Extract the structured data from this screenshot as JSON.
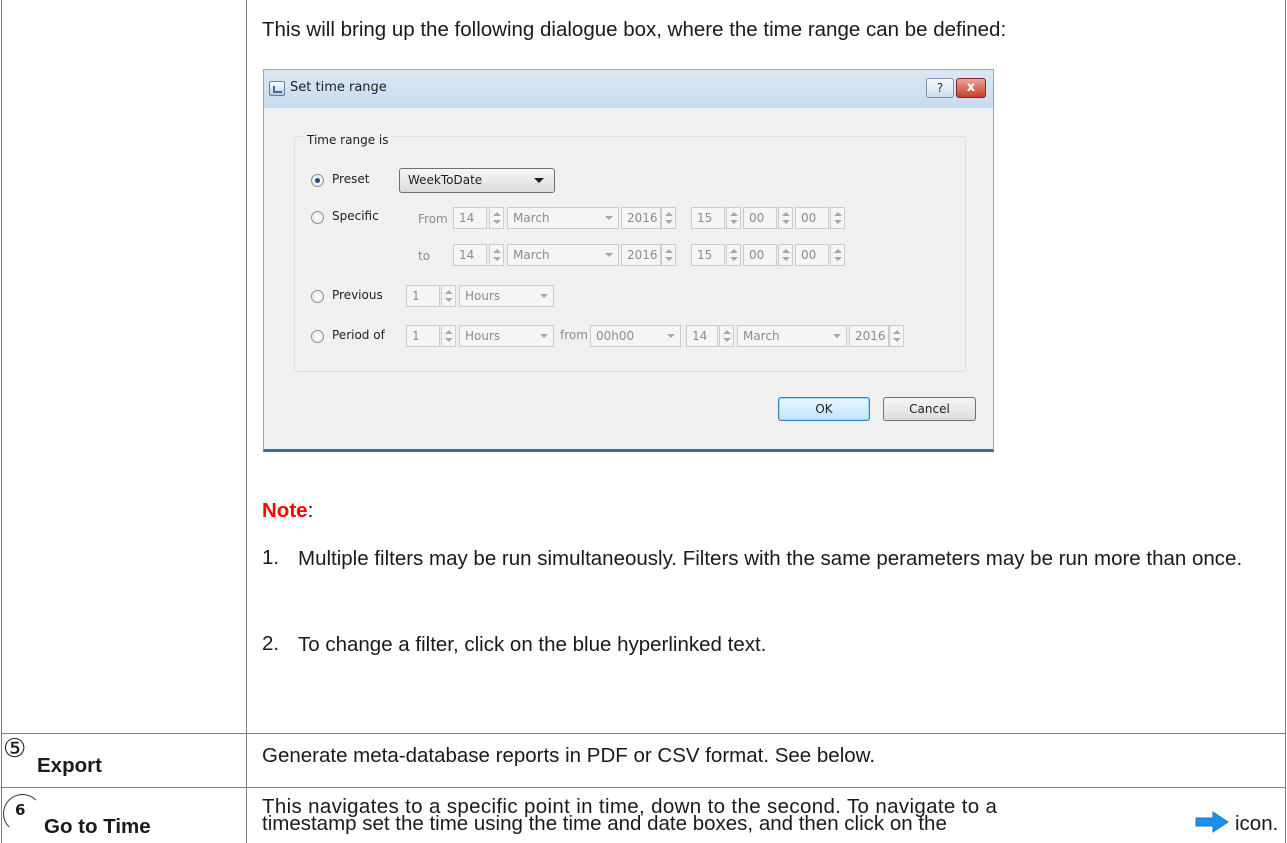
{
  "intro_text": "This will bring up the following dialogue box, where the time range can be defined:",
  "dialog": {
    "title": "Set time range",
    "help_label": "?",
    "close_label": "x",
    "group_label": "Time range is",
    "preset": {
      "label": "Preset",
      "value": "WeekToDate",
      "selected": true
    },
    "specific": {
      "label": "Specific",
      "from_label": "From",
      "to_label": "to",
      "from": {
        "day": "14",
        "month": "March",
        "year": "2016",
        "hour": "15",
        "minute": "00",
        "second": "00"
      },
      "to": {
        "day": "14",
        "month": "March",
        "year": "2016",
        "hour": "15",
        "minute": "00",
        "second": "00"
      }
    },
    "previous": {
      "label": "Previous",
      "amount": "1",
      "unit": "Hours"
    },
    "period_of": {
      "label": "Period of",
      "amount": "1",
      "unit": "Hours",
      "from_label": "from",
      "time": "00h00",
      "day": "14",
      "month": "March",
      "year": "2016"
    },
    "ok_label": "OK",
    "cancel_label": "Cancel"
  },
  "note": {
    "word": "Note",
    "colon": ":",
    "items": [
      {
        "num": "1.",
        "text": "Multiple filters may be run simultaneously. Filters with the same perameters may be run more than once."
      },
      {
        "num": "2.",
        "text": "To change a filter, click on the blue hyperlinked text."
      }
    ]
  },
  "rows": [
    {
      "number": "⑤",
      "title": "Export",
      "description": "Generate meta-database reports in PDF or CSV format. See below."
    },
    {
      "number": "6",
      "title": "Go to Time",
      "description_line1": "This navigates to a specific point in time, down to the second. To navigate to a",
      "description_line2_before": "timestamp set the time using the time and date boxes, and then click on the",
      "description_line2_after": "icon.",
      "icon": "right-arrow-icon"
    }
  ],
  "colors": {
    "note": "#ff0000",
    "arrow_icon": "#1e90e8"
  }
}
